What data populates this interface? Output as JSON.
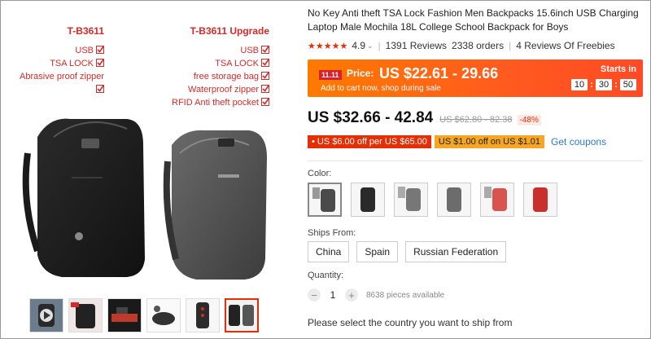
{
  "gallery": {
    "left_model": "T-B3611",
    "left_features": [
      "USB",
      "TSA LOCK",
      "Abrasive proof zipper"
    ],
    "right_model": "T-B3611 Upgrade",
    "right_features": [
      "USB",
      "TSA LOCK",
      "free storage bag",
      "Waterproof zipper",
      "RFID Anti theft pocket"
    ]
  },
  "product": {
    "title": "No Key Anti theft TSA Lock Fashion Men Backpacks 15.6inch USB Charging Laptop Male Mochila 18L College School Backpack for Boys",
    "rating": "4.9",
    "reviews": "1391 Reviews",
    "orders": "2338 orders",
    "freebies": "4 Reviews Of Freebies"
  },
  "promo": {
    "tag": "11.11",
    "price_label": "Price:",
    "price": "US $22.61 - 29.66",
    "subtext": "Add to cart now, shop during sale",
    "starts_in": "Starts in",
    "hours": "10",
    "minutes": "30",
    "seconds": "50",
    "colon": ":"
  },
  "pricing": {
    "price": "US $32.66 - 42.84",
    "old_price": "US $62.80 - 82.38",
    "discount": "-48%"
  },
  "coupons": {
    "store": "US $6.00 off per US $65.00",
    "select": "US $1.00 off on US $1.01",
    "get_label": "Get coupons"
  },
  "options": {
    "color_label": "Color:",
    "ships_label": "Ships From:",
    "ships": [
      "China",
      "Spain",
      "Russian Federation"
    ],
    "quantity_label": "Quantity:",
    "quantity": "1",
    "available": "8638 pieces available",
    "country_prompt": "Please select the country you want to ship from"
  },
  "colors": {
    "accent": "#e62e04",
    "banner": "#ff6a00",
    "link": "#2e7ad1"
  }
}
